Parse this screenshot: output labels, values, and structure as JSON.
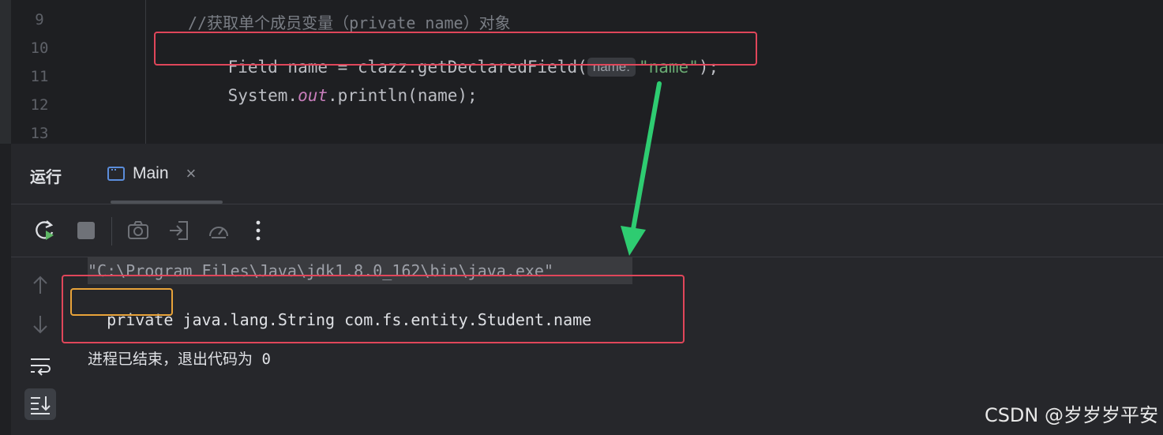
{
  "editor": {
    "lines": [
      {
        "number": "9",
        "text": "//获取单个成员变量（private name）对象"
      },
      {
        "number": "10",
        "code_before": "Field name = clazz.getDeclaredField(",
        "hint": "name:",
        "string_arg": "\"name\"",
        "code_after": ");"
      },
      {
        "number": "11",
        "code_before": "System.",
        "italic": "out",
        "code_after": ".println(name);"
      },
      {
        "number": "12"
      },
      {
        "number": "13"
      }
    ]
  },
  "run": {
    "title": "运行",
    "tab_label": "Main",
    "tab_close": "×"
  },
  "console": {
    "command": "\"C:\\Program Files\\Java\\jdk1.8.0_162\\bin\\java.exe\"",
    "output_keyword": "private",
    "output_rest": " java.lang.String com.fs.entity.Student.name",
    "exit_message": "进程已结束，退出代码为 0"
  },
  "watermark": "CSDN @岁岁岁平安",
  "colors": {
    "highlight_red": "#e0465a",
    "highlight_orange": "#e8a33a",
    "arrow_green": "#2ecc71",
    "string_green": "#6aab73",
    "italic_purple": "#c77dbb"
  },
  "icons": {
    "toolbar": [
      "rerun-icon",
      "stop-icon",
      "camera-icon",
      "login-icon",
      "gauge-icon",
      "more-vertical-icon"
    ],
    "side": [
      "arrow-up-icon",
      "arrow-down-icon",
      "soft-wrap-icon",
      "scroll-to-end-icon"
    ]
  }
}
